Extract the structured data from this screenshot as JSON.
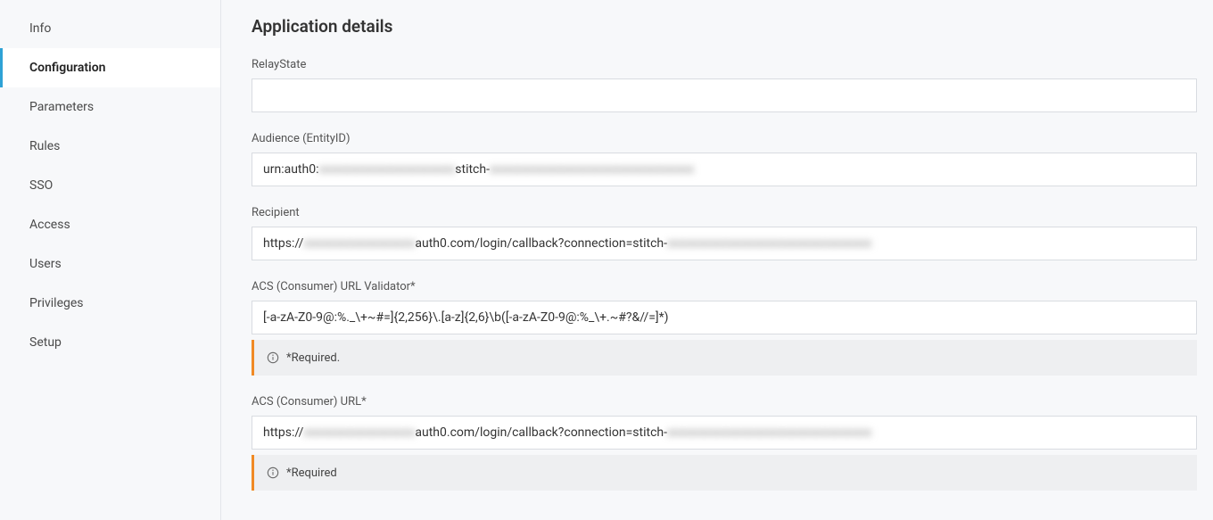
{
  "sidebar": {
    "items": [
      {
        "label": "Info",
        "active": false
      },
      {
        "label": "Configuration",
        "active": true
      },
      {
        "label": "Parameters",
        "active": false
      },
      {
        "label": "Rules",
        "active": false
      },
      {
        "label": "SSO",
        "active": false
      },
      {
        "label": "Access",
        "active": false
      },
      {
        "label": "Users",
        "active": false
      },
      {
        "label": "Privileges",
        "active": false
      },
      {
        "label": "Setup",
        "active": false
      }
    ]
  },
  "main": {
    "title": "Application details",
    "fields": {
      "relayState": {
        "label": "RelayState",
        "value": ""
      },
      "audience": {
        "label": "Audience (EntityID)",
        "prefix": "urn:auth0:",
        "blur1": "xxxxxxxxxxxxxxxxxxxxxx",
        "mid": "stitch-",
        "blur2": "xxxxxxxxxxxxxxxxxxxxxxxxxxxxxxxxx"
      },
      "recipient": {
        "label": "Recipient",
        "prefix": "https://",
        "blur1": "xxxxxxxxxxxxxxxxxx",
        "mid": "auth0.com/login/callback?connection=stitch-",
        "blur2": "xxxxxxxxxxxxxxxxxxxxxxxxxxxxxxxxx"
      },
      "acsValidator": {
        "label": "ACS (Consumer) URL Validator*",
        "value": "[-a-zA-Z0-9@:%._\\+~#=]{2,256}\\.[a-z]{2,6}\\b([-a-zA-Z0-9@:%_\\+.~#?&//=]*)",
        "helper": "*Required."
      },
      "acsUrl": {
        "label": "ACS (Consumer) URL*",
        "prefix": "https://",
        "blur1": "xxxxxxxxxxxxxxxxxx",
        "mid": "auth0.com/login/callback?connection=stitch-",
        "blur2": "xxxxxxxxxxxxxxxxxxxxxxxxxxxxxxxxx",
        "helper": "*Required"
      }
    }
  }
}
